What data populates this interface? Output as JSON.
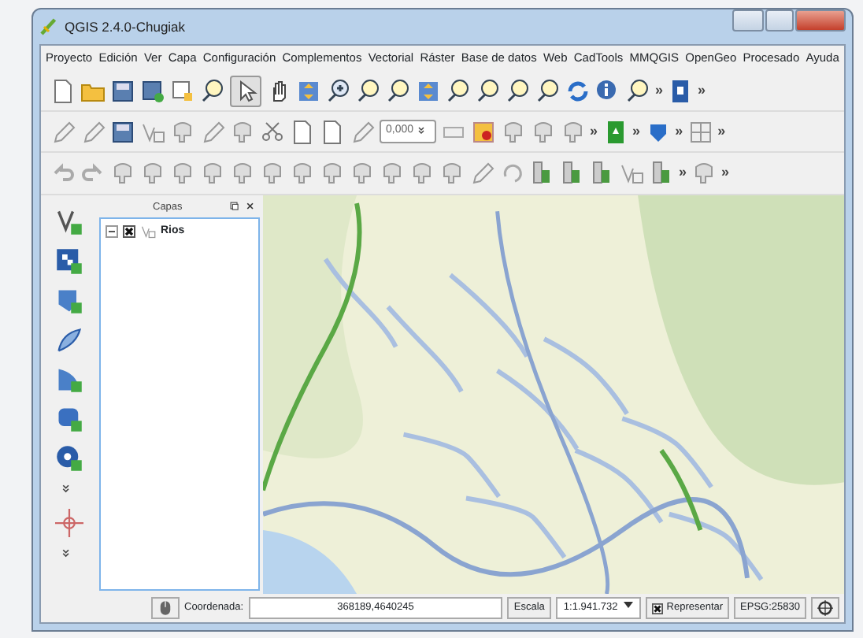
{
  "window": {
    "title": "QGIS 2.4.0-Chugiak"
  },
  "menu": [
    "Proyecto",
    "Edición",
    "Ver",
    "Capa",
    "Configuración",
    "Complementos",
    "Vectorial",
    "Ráster",
    "Base de datos",
    "Web",
    "CadTools",
    "MMQGIS",
    "OpenGeo",
    "Procesado",
    "Ayuda"
  ],
  "toolbars": [
    {
      "overflow": [
        "»",
        "»"
      ]
    },
    {
      "scale_field": "0,000",
      "overflow": [
        "»",
        "»",
        "»",
        "»"
      ]
    },
    {
      "overflow": [
        "»",
        "»"
      ]
    }
  ],
  "layers_panel": {
    "title": "Capas",
    "layers": [
      {
        "name": "Rios",
        "expanded": true,
        "checked": true
      }
    ]
  },
  "status_bar": {
    "coordinate_label": "Coordenada:",
    "coordinate": "368189,4640245",
    "scale_label": "Escala",
    "scale": "1:1.941.732",
    "render": {
      "label": "Representar",
      "checked": true
    },
    "crs": "EPSG:25830"
  }
}
